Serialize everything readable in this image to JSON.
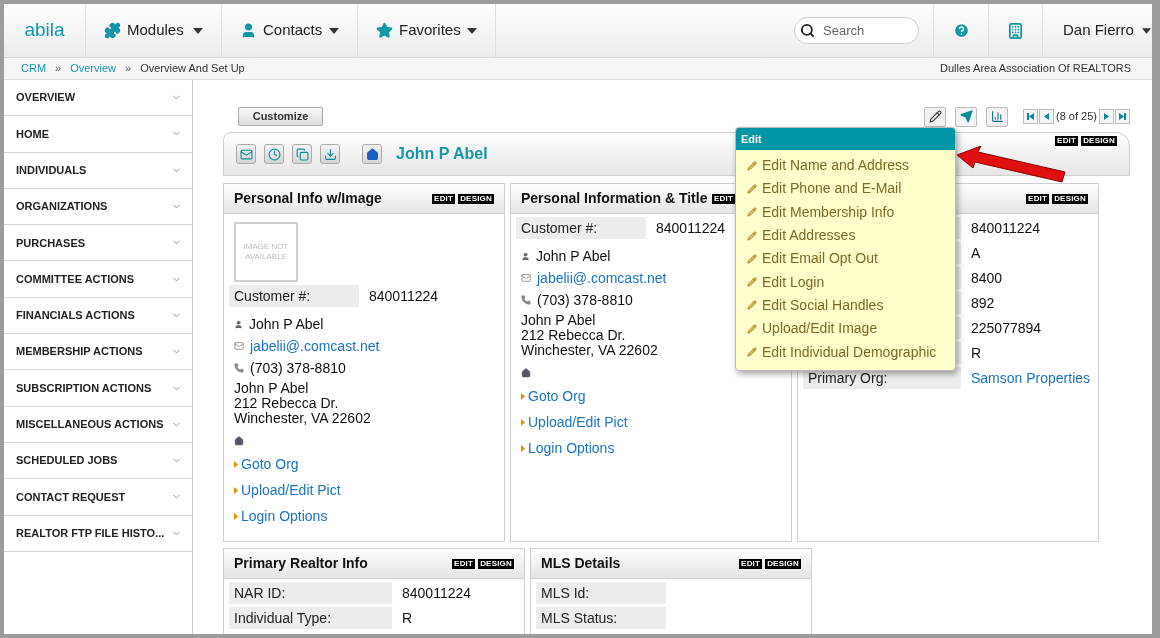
{
  "nav": {
    "logo": "abila",
    "menus": [
      {
        "label": "Modules"
      },
      {
        "label": "Contacts"
      },
      {
        "label": "Favorites"
      }
    ],
    "search": {
      "placeholder": "Search"
    },
    "user": "Dan Fierro"
  },
  "breadcrumb": {
    "items": [
      {
        "label": "CRM",
        "kind": "link"
      },
      {
        "label": "»",
        "kind": "separator"
      },
      {
        "label": "Overview",
        "kind": "link"
      },
      {
        "label": "»",
        "kind": "separator"
      },
      {
        "label": "Overview And Set Up",
        "kind": "current"
      }
    ],
    "org": "Dulles Area Association Of REALTORS"
  },
  "sidebar": {
    "items": [
      {
        "label": "OVERVIEW"
      },
      {
        "label": "HOME"
      },
      {
        "label": "INDIVIDUALS"
      },
      {
        "label": "ORGANIZATIONS"
      },
      {
        "label": "PURCHASES"
      },
      {
        "label": "COMMITTEE ACTIONS"
      },
      {
        "label": "FINANCIALS ACTIONS"
      },
      {
        "label": "MEMBERSHIP ACTIONS"
      },
      {
        "label": "SUBSCRIPTION ACTIONS"
      },
      {
        "label": "MISCELLANEOUS ACTIONS"
      },
      {
        "label": "SCHEDULED JOBS"
      },
      {
        "label": "CONTACT REQUEST"
      },
      {
        "label": "REALTOR FTP FILE HISTO..."
      }
    ]
  },
  "toolbar": {
    "customize": "Customize",
    "pager": "(8 of 25)"
  },
  "record": {
    "name": "John P Abel",
    "tags": [
      "EDIT",
      "DESIGN"
    ]
  },
  "panels": [
    {
      "title": "Personal Info w/Image",
      "tags": [
        "EDIT",
        "DESIGN"
      ],
      "image_placeholder": "IMAGE NOT AVAILABLE",
      "rows": [
        {
          "label": "Customer #:",
          "value": "840011224"
        }
      ],
      "contact": {
        "name": "John P Abel",
        "email": "jabelii@.comcast.net",
        "phone": "(703) 378-8810",
        "address": [
          "John P Abel",
          "212 Rebecca Dr.",
          "Winchester, VA 22602"
        ]
      },
      "links": [
        "Goto Org",
        "Upload/Edit Pict",
        "Login Options"
      ]
    },
    {
      "title": "Personal Information & Title",
      "tags": [
        "EDIT"
      ],
      "rows": [
        {
          "label": "Customer #:",
          "value": "840011224"
        }
      ],
      "contact": {
        "name": "John P Abel",
        "email": "jabelii@.comcast.net",
        "phone": "(703) 378-8810",
        "address": [
          "John P Abel",
          "212 Rebecca Dr.",
          "Winchester, VA 22602"
        ]
      },
      "links": [
        "Goto Org",
        "Upload/Edit Pict",
        "Login Options"
      ]
    },
    {
      "tags": [
        "EDIT",
        "DESIGN"
      ],
      "rows": [
        {
          "value": "840011224"
        },
        {
          "value": "A"
        },
        {
          "value": "8400"
        },
        {
          "value": "892"
        },
        {
          "value": "225077894"
        },
        {
          "value": "R"
        },
        {
          "label": "Primary Org:",
          "value": "Samson Properties",
          "kind": "link"
        }
      ]
    }
  ],
  "bottom_panels": [
    {
      "title": "Primary Realtor Info",
      "tags": [
        "EDIT",
        "DESIGN"
      ],
      "rows": [
        {
          "label": "NAR ID:",
          "value": "840011224"
        },
        {
          "label": "Individual Type:",
          "value": "R"
        }
      ]
    },
    {
      "title": "MLS Details",
      "tags": [
        "EDIT",
        "DESIGN"
      ],
      "rows": [
        {
          "label": "MLS Id:"
        },
        {
          "label": "MLS Status:"
        }
      ]
    }
  ],
  "edit_menu": {
    "title": "Edit",
    "items": [
      "Edit Name and Address",
      "Edit Phone and E-Mail",
      "Edit Membership Info",
      "Edit Addresses",
      "Edit Email Opt Out",
      "Edit Login",
      "Edit Social Handles",
      "Upload/Edit Image",
      "Edit Individual Demographic"
    ]
  }
}
